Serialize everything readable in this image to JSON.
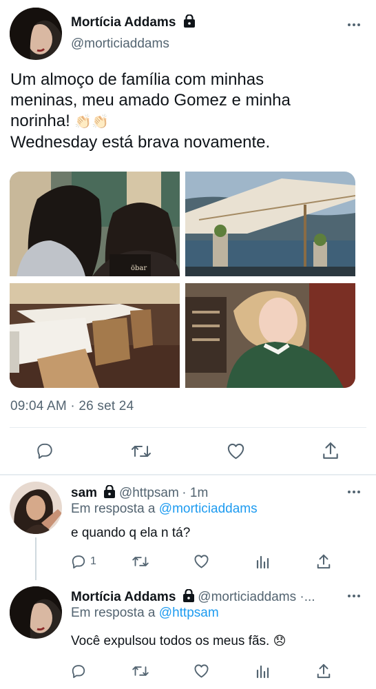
{
  "main_tweet": {
    "author_name": "Mortícia Addams",
    "author_handle": "@morticiaddams",
    "text_line1": "Um almoço de família com minhas",
    "text_line2": "meninas, meu amado Gomez e minha",
    "text_line3": "norinha!",
    "text_line4": "Wednesday está brava novamente.",
    "emoji": "👏🏻👏🏻",
    "timestamp": "09:04 AM · 26 set 24",
    "photo_menu_text": "öbar"
  },
  "reply1": {
    "author_name": "sam",
    "author_handle": "@httpsam",
    "time": "· 1m",
    "reply_prefix": "Em resposta a",
    "reply_to": "@morticiaddams",
    "text": "e quando q ela n tá?",
    "reply_count": "1"
  },
  "reply2": {
    "author_name": "Mortícia Addams",
    "author_handle": "@morticiaddams ·...",
    "reply_prefix": "Em resposta a",
    "reply_to": "@httpsam",
    "text": "Você expulsou todos os meus fãs.",
    "emoji": "😞"
  },
  "icons": {
    "lock": "lock-icon",
    "more": "more-icon",
    "reply": "reply-icon",
    "retweet": "retweet-icon",
    "like": "like-icon",
    "share": "share-icon",
    "analytics": "analytics-icon"
  },
  "colors": {
    "link": "#1d9bf0",
    "secondary_text": "#536471",
    "divider": "#e6ecf0"
  }
}
